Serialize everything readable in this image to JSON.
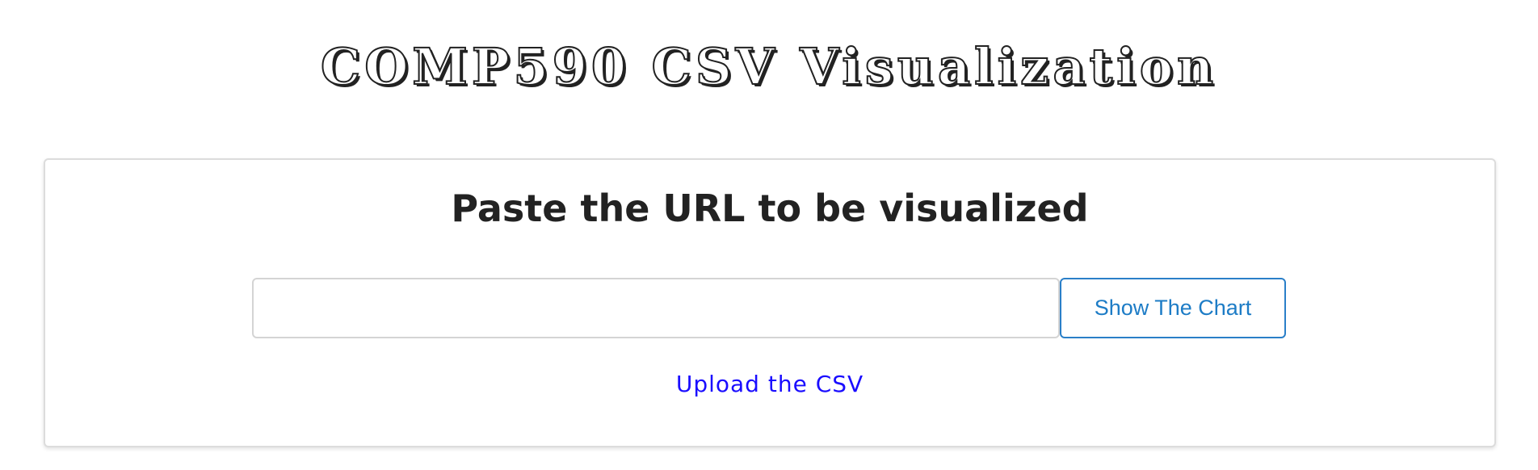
{
  "header": {
    "title": "COMP590 CSV Visualization"
  },
  "card": {
    "heading": "Paste the URL to be visualized",
    "url_input": {
      "value": "",
      "placeholder": ""
    },
    "show_button_label": "Show The Chart",
    "upload_link_label": "Upload the CSV"
  },
  "colors": {
    "title_text": "#222222",
    "button_accent": "#1d7cc6",
    "link": "#1a0dff",
    "card_border": "#dcdcdc"
  }
}
